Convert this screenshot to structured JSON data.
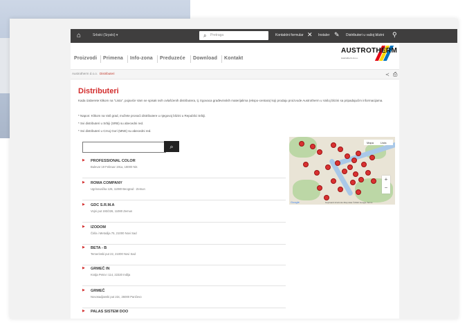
{
  "topbar": {
    "language": "Srbski (Srpski) ▾",
    "search_placeholder": "Pretraga",
    "link_contact_form": "Kontaktni formular",
    "link_instaler": "Instaler",
    "link_distributor": "Distributeri u vašoj blizini"
  },
  "nav": {
    "items": [
      "Proizvodi",
      "Primena",
      "Info-zona",
      "Preduzeće",
      "Download",
      "Kontakt"
    ]
  },
  "logo": {
    "word": "AUSTROTHERM",
    "subtitle": "Austrotherm d.o.o."
  },
  "breadcrumb": {
    "home": "Austrotherm d.o.o.",
    "current": "Distributeri"
  },
  "page": {
    "title": "Distributeri",
    "intro": "Kada izaberete klikom na \"Lista\", pojaviće Vam se spisak svih ovlašćenih distributera, tj. trgovaca građevinskih materijalima (ekspo-centara) koji prodaju proizvode Austrotherm u Vašoj blizini sa pripadajućim informacijama.",
    "notes": [
      "* Napon: Klikom na Vaš grad, možete pronaći distributere u njegovoj blizini u Republici Srbiji.",
      "* Svi distributeri u Srbiji (SRB) su abecedni red.",
      "* Svi distributeri u Crnoj Gori (MNE) su abecedni red."
    ]
  },
  "search": {
    "icon": "search-icon"
  },
  "distributors": [
    {
      "name": "PROFESSIONAL COLOR",
      "address": "Bulevar 19 Februar 191a, 18000 Nis"
    },
    {
      "name": "ROMA COMPANY",
      "address": "Ugrinovačka 126, 11080 Beograd - Zemun"
    },
    {
      "name": "GDC S.R.M.A",
      "address": "Vojni put 193/226, 11080 Zemun"
    },
    {
      "name": "IZODOM",
      "address": "Čirila i Metodija 75, 21000 Novi Sad"
    },
    {
      "name": "BETA - B",
      "address": "Temerinski put 22, 21000 Novi Sad"
    },
    {
      "name": "GRMEČ IN",
      "address": "Kralja Petra I 114, 22320 Inđija"
    },
    {
      "name": "GRMEČ",
      "address": "Novosadjanski put 22c, 26000 Pančevo"
    },
    {
      "name": "PALAS SISTEM DOO",
      "address": ""
    }
  ],
  "map": {
    "tab_map": "Mapa",
    "tab_satellite": "Lista",
    "zoom_in": "+",
    "zoom_out": "−",
    "brand": "Google",
    "footer": "Keyboard shortcuts   Map data ©2022 Google   Terms"
  },
  "colors": {
    "topbar": "#3f3e3e",
    "accent": "#d22b2b",
    "map_pin": "#d93131"
  }
}
